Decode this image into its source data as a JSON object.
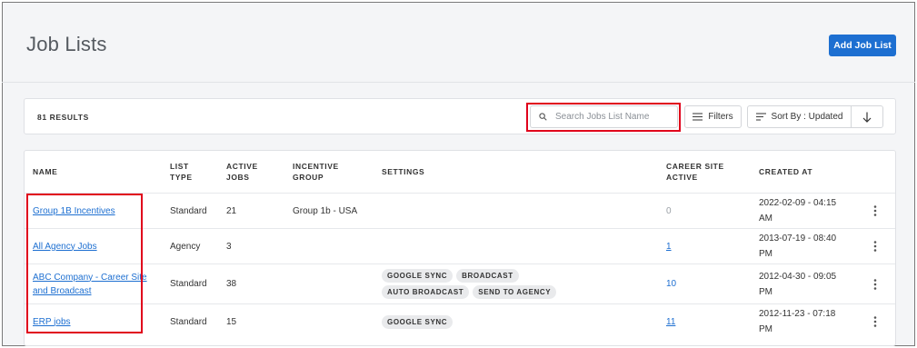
{
  "header": {
    "title": "Job Lists",
    "add_button_label": "Add Job List",
    "accent_color": "#1d6fd1"
  },
  "toolbar": {
    "results_label": "81 RESULTS",
    "search": {
      "placeholder": "Search Jobs List Name",
      "value": "",
      "icon": "search-icon"
    },
    "filters_label": "Filters",
    "filters_icon": "filter-lines-icon",
    "sort_label": "Sort By : Updated",
    "sort_icon": "sort-lines-icon",
    "sort_direction_icon": "arrow-down-icon"
  },
  "table": {
    "columns": {
      "name": "NAME",
      "list_type_1": "LIST",
      "list_type_2": "TYPE",
      "active_jobs_1": "ACTIVE",
      "active_jobs_2": "JOBS",
      "incentive_group_1": "INCENTIVE",
      "incentive_group_2": "GROUP",
      "settings": "SETTINGS",
      "career_site_1": "CAREER SITE",
      "career_site_2": "ACTIVE",
      "created_at": "CREATED AT"
    },
    "rows": [
      {
        "name": "Group 1B Incentives",
        "list_type": "Standard",
        "active_jobs": "21",
        "incentive_group": "Group 1b - USA",
        "settings": [],
        "career_site_active": "0",
        "created_date": "2022-02-09 - 04:15",
        "created_ampm": "AM"
      },
      {
        "name": "All Agency Jobs",
        "list_type": "Agency",
        "active_jobs": "3",
        "incentive_group": "",
        "settings": [],
        "career_site_active": "1",
        "created_date": "2013-07-19 - 08:40",
        "created_ampm": "PM"
      },
      {
        "name": "ABC Company - Career Site and Broadcast",
        "name_line1": "ABC Company - Career Site",
        "name_line2": "and Broadcast",
        "list_type": "Standard",
        "active_jobs": "38",
        "incentive_group": "",
        "settings": [
          "GOOGLE SYNC",
          "BROADCAST",
          "AUTO BROADCAST",
          "SEND TO AGENCY"
        ],
        "career_site_active": "10",
        "created_date": "2012-04-30 - 09:05",
        "created_ampm": "PM"
      },
      {
        "name": "ERP jobs",
        "list_type": "Standard",
        "active_jobs": "15",
        "incentive_group": "",
        "settings": [
          "GOOGLE SYNC"
        ],
        "career_site_active": "11",
        "created_date": "2012-11-23 - 07:18",
        "created_ampm": "PM"
      }
    ],
    "row_menu_icon": "kebab-menu-icon"
  },
  "annotations": {
    "highlight_color": "#e0001b"
  }
}
